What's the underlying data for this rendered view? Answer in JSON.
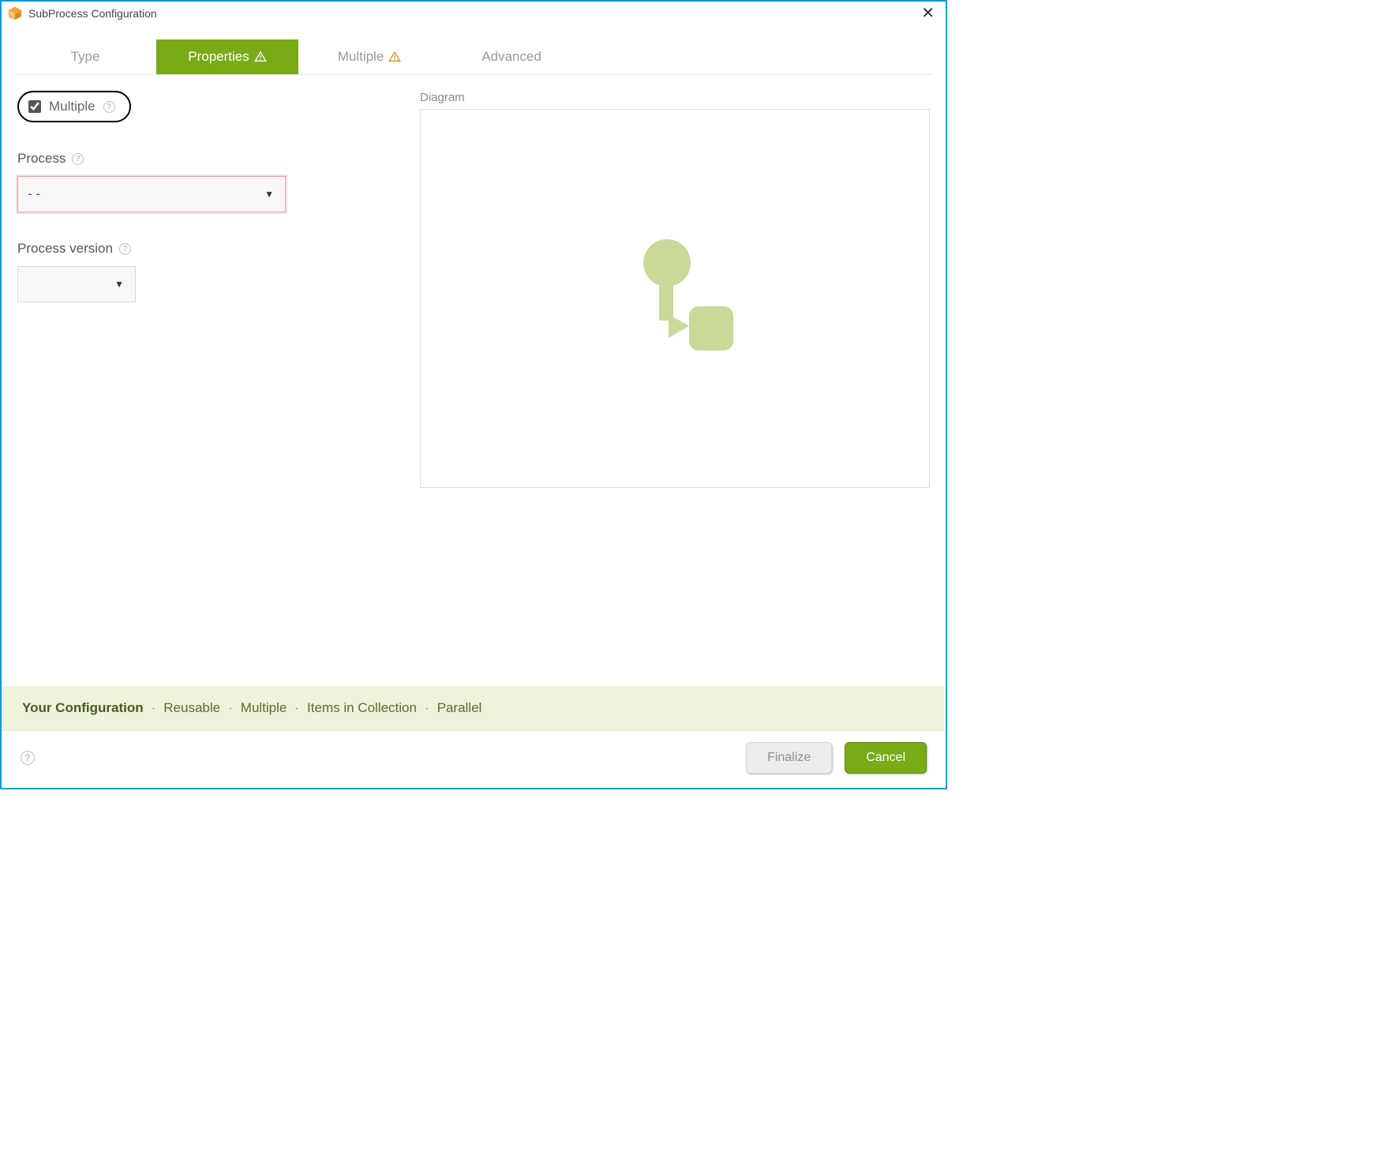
{
  "window": {
    "title": "SubProcess Configuration"
  },
  "tabs": {
    "type": "Type",
    "properties": "Properties",
    "multiple": "Multiple",
    "advanced": "Advanced"
  },
  "form": {
    "multiple_checkbox_label": "Multiple",
    "multiple_checked": true,
    "process_label": "Process",
    "process_value": "- -",
    "process_version_label": "Process version",
    "process_version_value": ""
  },
  "diagram": {
    "label": "Diagram"
  },
  "summary": {
    "title": "Your Configuration",
    "items": [
      "Reusable",
      "Multiple",
      "Items in Collection",
      "Parallel"
    ]
  },
  "footer": {
    "finalize": "Finalize",
    "cancel": "Cancel"
  }
}
